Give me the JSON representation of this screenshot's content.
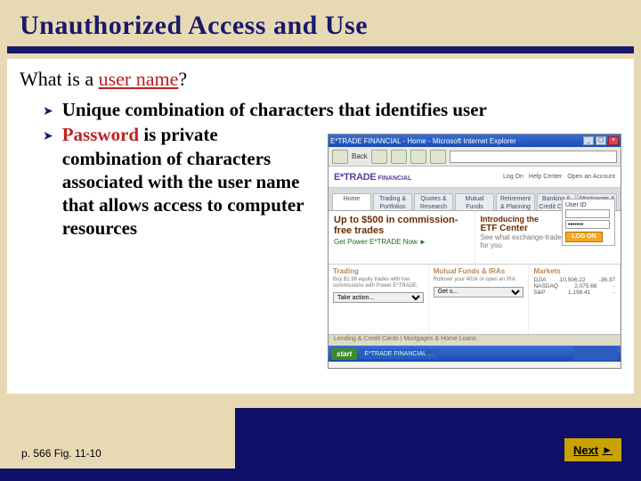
{
  "title": "Unauthorized Access and Use",
  "question_prefix": "What is a ",
  "question_highlight": "user name",
  "question_suffix": "?",
  "bullets": [
    {
      "text": "Unique combination of characters that identifies user",
      "narrow": false
    },
    {
      "text_pre": "",
      "hl": "Password",
      "text_post": " is private combination of characters associated with the user name that allows access to computer resources",
      "narrow": true
    }
  ],
  "screenshot": {
    "window_title": "E*TRADE FINANCIAL - Home - Microsoft Internet Explorer",
    "back_label": "Back",
    "logo": "E*TRADE",
    "logo_sub": "FINANCIAL",
    "hdr_links": [
      "Log On",
      "Help Center",
      "Open an Account"
    ],
    "tabs": [
      "Home",
      "Trading & Portfolios",
      "Quotes & Research",
      "Mutual Funds",
      "Retirement & Planning",
      "Banking & Credit Cards",
      "Mortgages & Home Equity"
    ],
    "promo_left_big": "Up to $500 in commission-free trades",
    "promo_left_cta": "Get Power E*TRADE Now ►",
    "promo_right_intro": "Introducing the",
    "promo_right_big": "ETF Center",
    "promo_right_sub": "See what exchange-traded funds can do for you",
    "login": {
      "title": "User ID",
      "value_user": "",
      "value_pass": "•••••••",
      "btn": "LOG ON"
    },
    "col1_h": "Trading",
    "col1_txt": "Buy $1.99 equity trades with low commissions with Power E*TRADE.",
    "col1_sel": "Take action...",
    "col2_h": "Mutual Funds & IRAs",
    "col2_txt": "Rollover your 401k or open an IRA.",
    "col2_sel": "Get s...",
    "col3_h": "Markets",
    "col3_rows": [
      [
        "DJIA",
        "10,506.22",
        "-36.37"
      ],
      [
        "NASDAQ",
        "2,075.66",
        "-"
      ],
      [
        "S&P",
        "1,198.41",
        "-"
      ]
    ],
    "strip": "Lending & Credit Cards    |    Mortgages & Home Loans",
    "start": "start",
    "task": "E*TRADE FINANCIAL ..."
  },
  "figref": "p. 566 Fig. 11-10",
  "next": "Next"
}
